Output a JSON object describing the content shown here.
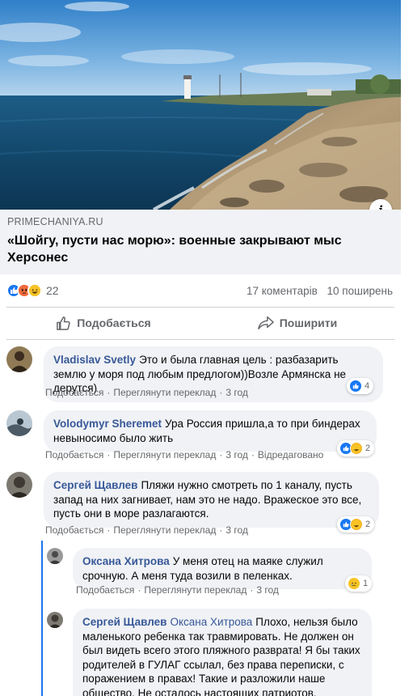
{
  "post": {
    "info_icon": "info-icon",
    "link_domain": "PRIMECHANIYA.RU",
    "link_title": "«Шойгу, пусти нас морю»: военные закрывают мыс Херсонес",
    "reactions": {
      "icons": [
        "like-icon",
        "angry-icon",
        "haha-icon"
      ],
      "count": "22"
    },
    "comments_count": "17 коментарів",
    "shares_count": "10 поширень"
  },
  "actions": {
    "like_label": "Подобається",
    "share_label": "Поширити"
  },
  "comments": [
    {
      "author": "Vladislav Svetly",
      "text": "Это и была главная цель : разбазарить землю у моря под любым предлогом))Возле Армянска не дерутся)",
      "meta": [
        "Подобається",
        "Переглянути переклад",
        "3 год"
      ],
      "reaction_count": "4",
      "reaction_icons": [
        "like-icon"
      ]
    },
    {
      "author": "Volodymyr Sheremet",
      "text": "Ура Россия пришла,а то при биндерах невыносимо было жить",
      "meta": [
        "Подобається",
        "Переглянути переклад",
        "3 год",
        "Відредаговано"
      ],
      "reaction_count": "2",
      "reaction_icons": [
        "like-icon",
        "haha-icon"
      ]
    },
    {
      "author": "Сергей Щавлев",
      "text": "Пляжи нужно смотреть по 1 каналу, пусть запад на них загнивает, нам это не надо. Вражеское это все, пусть они в море разлагаются.",
      "meta": [
        "Подобається",
        "Переглянути переклад",
        "3 год"
      ],
      "reaction_count": "2",
      "reaction_icons": [
        "like-icon",
        "haha-icon"
      ]
    },
    {
      "author": "Оксана Хитрова",
      "text": "У меня отец на маяке служил срочную. А меня туда возили в пеленках.",
      "meta": [
        "Подобається",
        "Переглянути переклад",
        "3 год"
      ],
      "reaction_count": "1",
      "reaction_icons": [
        "sad-icon"
      ]
    },
    {
      "author": "Сергей Щавлев",
      "mention": "Оксана Хитрова",
      "text": "Плохо, нельзя было маленького ребенка так травмировать. Не должен он был видеть всего этого пляжного разврата! Я бы таких родителей в ГУЛАГ ссылал, без права переписки, с поражением в правах! Такие и разложили наше общество. Не осталось настоящих патриотов, пропало поколение",
      "reaction_icons": [
        "haha-icon"
      ]
    }
  ],
  "colors": {
    "like": "#1877f2",
    "angry": "#f0583d",
    "haha": "#f7b125",
    "author": "#385898",
    "meta": "#65676b",
    "bubble": "#f0f2f5"
  }
}
